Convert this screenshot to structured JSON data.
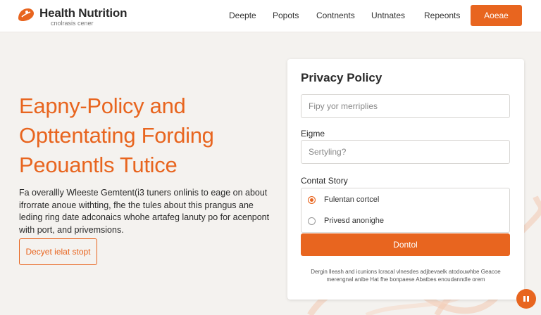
{
  "brand": {
    "name": "Health Nutrition",
    "tagline": "cnolrasis cener"
  },
  "nav": {
    "items": [
      "Deepte",
      "Popots",
      "Contnents",
      "Untnates",
      "Repeonts"
    ],
    "cta_label": "Aoeae"
  },
  "hero": {
    "title_lines": [
      "Eapny-Policy and",
      "Opttentating Fording",
      "Peouantls Tutice"
    ],
    "body": "Fa overallly Wleeste Gemtent(i3 tuners onlinis to eage on about ifrorrate anoue withting, fhe the tules about this prangus ane leding ring date adconaics whohe artafeg lanuty po for acenpont with port, and privemsions.",
    "button_label": "Decyet ielat stopt"
  },
  "form": {
    "title": "Privacy Policy",
    "field1_placeholder": "Fipy yor merriplies",
    "field2_label": "Eigme",
    "field2_placeholder": "Sertyling?",
    "radio_group_label": "Contat Story",
    "radio_options": [
      "Fulentan cortcel",
      "Privesd anonighe"
    ],
    "radio_selected": 0,
    "submit_label": "Dontol",
    "fineprint": "Dergin lleash and icunions lcracal vlnesdes adjbevaelk atodouwhbe Geacoe merengnal anibe Hat fhe bonpaese Abatbes enoudanndle orem"
  },
  "colors": {
    "accent": "#e8651f",
    "background": "#f4f2ef",
    "card": "#ffffff",
    "text": "#2a2a2a"
  },
  "icons": {
    "logo": "leaf-hand-icon",
    "chat": "chat-icon"
  }
}
